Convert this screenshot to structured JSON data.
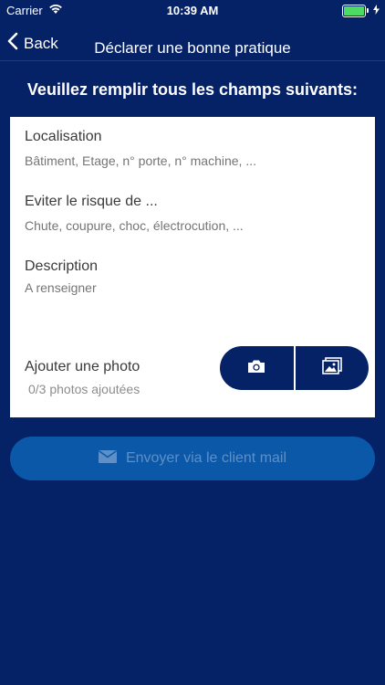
{
  "status_bar": {
    "carrier": "Carrier",
    "time": "10:39 AM",
    "battery_color": "#4cd964",
    "icons": [
      "wifi-icon",
      "battery-icon",
      "charging-bolt-icon"
    ]
  },
  "nav": {
    "back_label": "Back",
    "title": "Déclarer une bonne pratique"
  },
  "instructions": "Veuillez remplir tous les champs suivants:",
  "form": {
    "location": {
      "label": "Localisation",
      "placeholder": "Bâtiment, Etage, n° porte, n° machine, ..."
    },
    "risk": {
      "label": "Eviter le risque de ...",
      "placeholder": "Chute, coupure, choc, électrocution, ..."
    },
    "description": {
      "label": "Description",
      "placeholder": "A renseigner"
    },
    "photo": {
      "label": "Ajouter une photo",
      "count": "0/3 photos ajoutées",
      "buttons": [
        "camera-icon",
        "gallery-icon"
      ]
    }
  },
  "send_button": {
    "label": "Envoyer via le client mail",
    "icon": "envelope-icon"
  },
  "colors": {
    "background": "#062267",
    "card": "#ffffff",
    "send_button": "#0b58a8",
    "send_text": "#5e8fc6"
  }
}
